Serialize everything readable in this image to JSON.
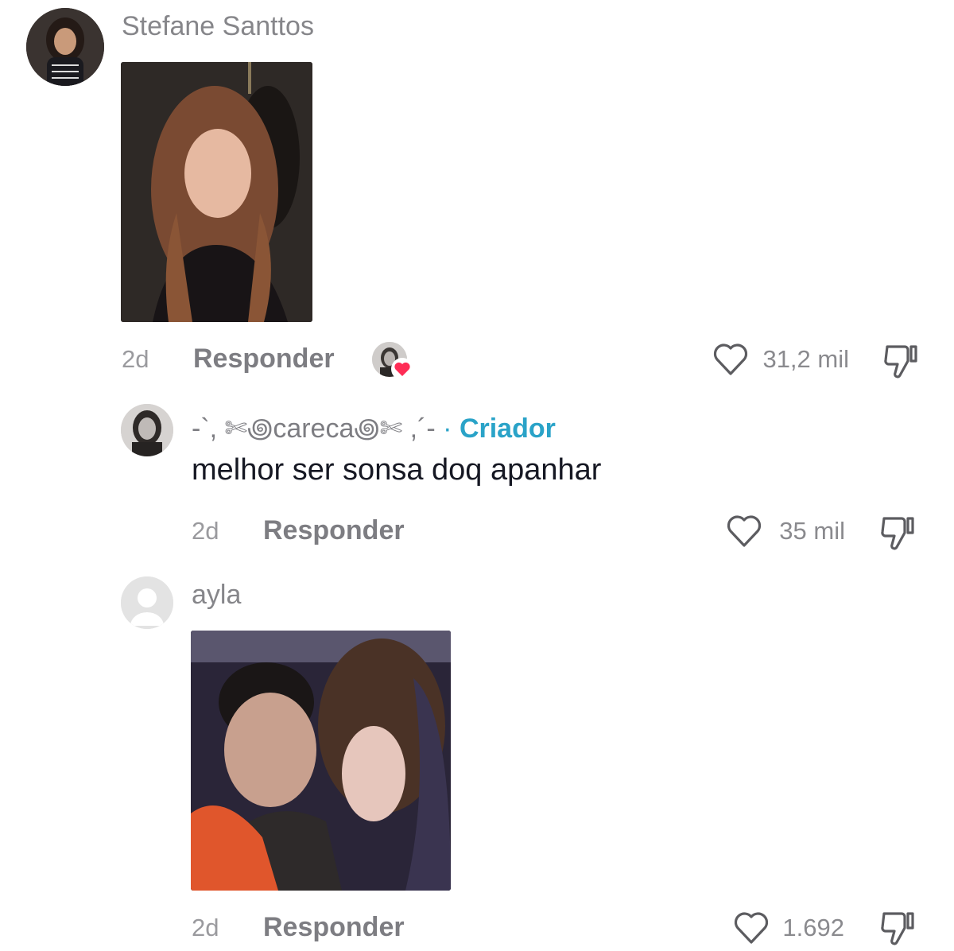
{
  "comments": [
    {
      "author": "Stefane Santtos",
      "time": "2d",
      "reply_label": "Responder",
      "likes": "31,2 mil"
    },
    {
      "author": "-`, ✄꩜careca꩜✄ ,´- ",
      "badge_sep": "·",
      "badge": "Criador",
      "text": "melhor ser sonsa doq apanhar",
      "time": "2d",
      "reply_label": "Responder",
      "likes": "35 mil"
    },
    {
      "author": "ayla",
      "time": "2d",
      "reply_label": "Responder",
      "likes": "1.692"
    }
  ],
  "colors": {
    "accent": "#2aa3c8",
    "liked_heart": "#fe2c55",
    "muted_text": "#86868a"
  },
  "icons": [
    "heart-outline-icon",
    "dislike-icon",
    "creator-liked-heart-icon",
    "default-avatar-icon"
  ]
}
